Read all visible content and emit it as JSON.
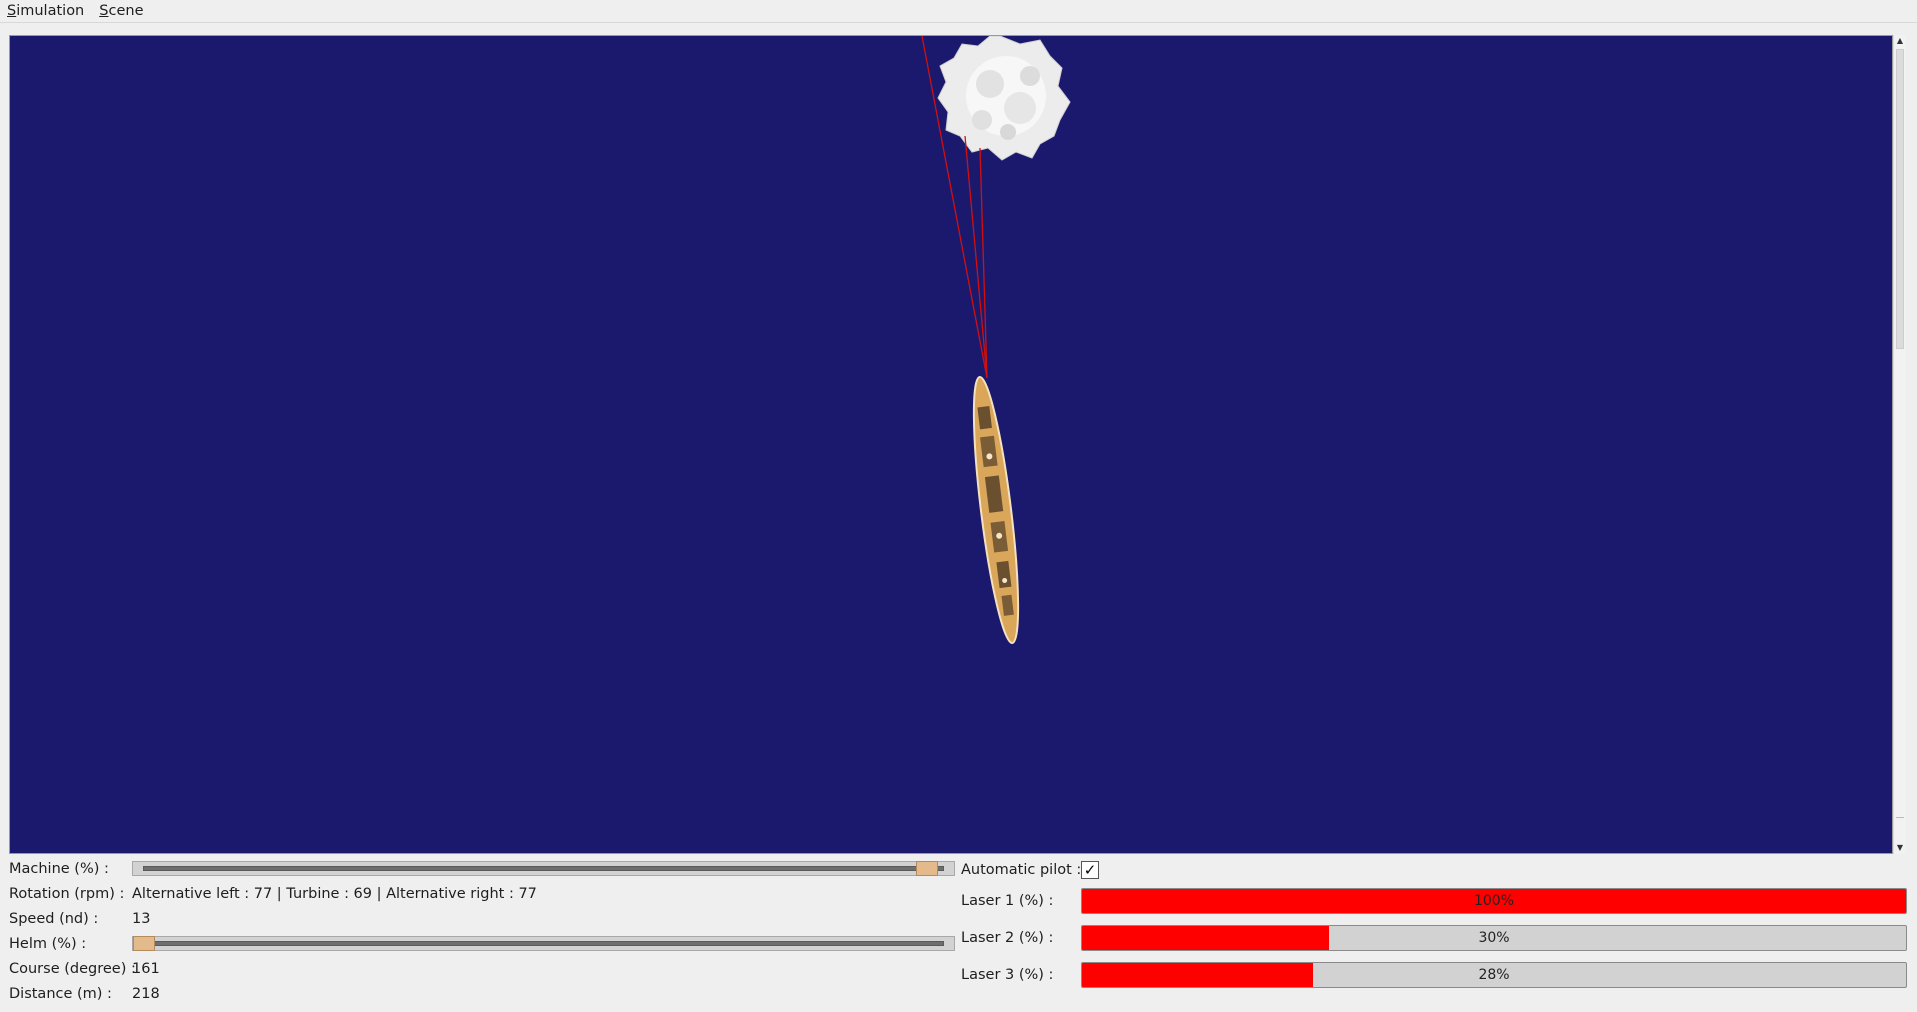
{
  "menu": {
    "simulation": {
      "accel": "S",
      "rest": "imulation"
    },
    "scene": {
      "accel": "S",
      "rest": "cene"
    }
  },
  "controls": {
    "machine_label": "Machine (%) :",
    "machine_value": 0.98,
    "rotation_label": "Rotation (rpm) :",
    "rotation_value": "Alternative left : 77 | Turbine : 69 | Alternative right : 77",
    "speed_label": "Speed (nd) :",
    "speed_value": "13",
    "helm_label": "Helm (%) :",
    "helm_value": 0.0,
    "course_label": "Course (degree) :",
    "course_value": "161",
    "distance_label": "Distance (m) :",
    "distance_value": "218"
  },
  "pilot": {
    "label": "Automatic pilot :",
    "checked": true,
    "check_glyph": "✓"
  },
  "lasers": [
    {
      "label": "Laser 1 (%) :",
      "value": 100,
      "text": "100%"
    },
    {
      "label": "Laser 2 (%) :",
      "value": 30,
      "text": "30%"
    },
    {
      "label": "Laser 3 (%) :",
      "value": 28,
      "text": "28%"
    }
  ],
  "colors": {
    "sea": "#1b196e",
    "laser_beam": "#d01010",
    "laser_fill": "#ff0000",
    "ship_hull": "#d9a65a",
    "iceberg": "#f0f0f0",
    "slider_handle": "#e4b98b"
  },
  "icons": {
    "scroll_up": "scroll-up-arrow-icon",
    "scroll_down": "scroll-down-arrow-icon",
    "check": "check-icon"
  }
}
